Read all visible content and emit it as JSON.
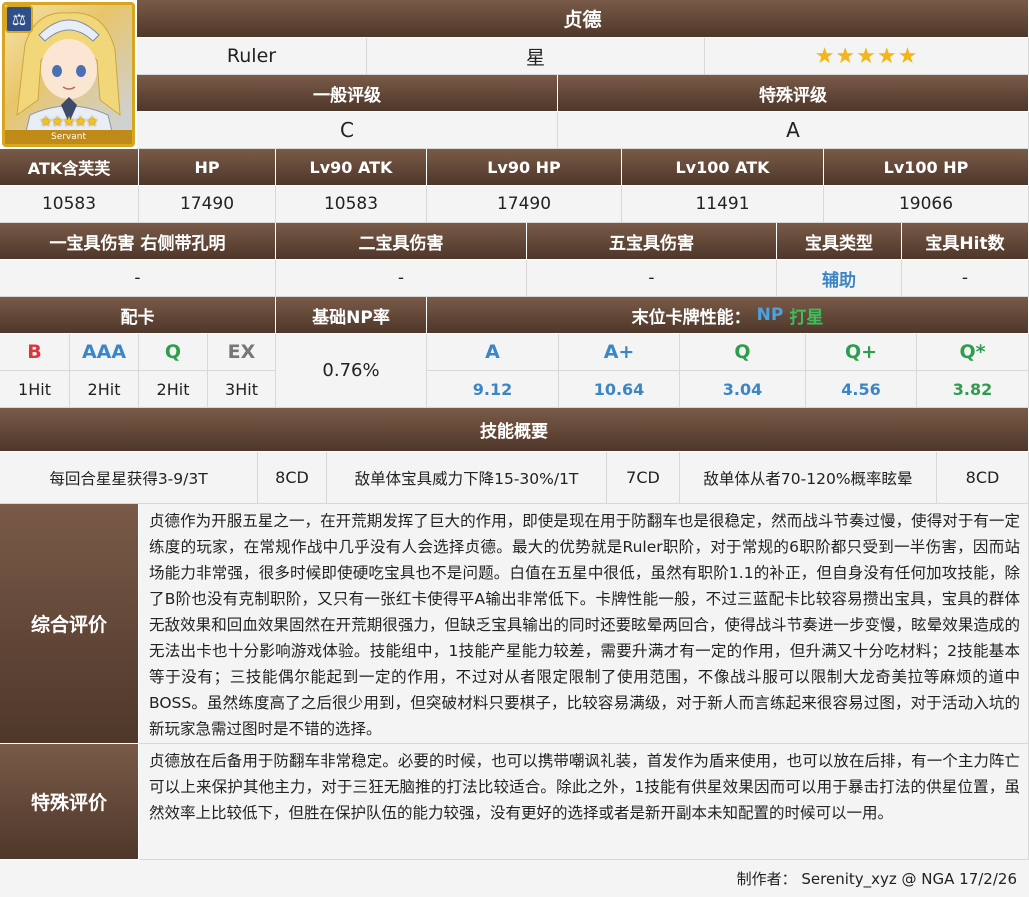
{
  "servant": {
    "name": "贞德",
    "class": "Ruler",
    "attribute": "星",
    "rarity_stars": "★★★★★",
    "card_label": "Servant",
    "card_stars": "★★★★★"
  },
  "ratings": {
    "general_label": "一般评级",
    "special_label": "特殊评级",
    "general_value": "C",
    "special_value": "A"
  },
  "stats": {
    "headers": [
      "ATK含芙芙",
      "HP",
      "Lv90 ATK",
      "Lv90 HP",
      "Lv100 ATK",
      "Lv100 HP"
    ],
    "values": [
      "10583",
      "17490",
      "10583",
      "17490",
      "11491",
      "19066"
    ]
  },
  "np": {
    "headers": [
      "一宝具伤害 右侧带孔明",
      "二宝具伤害",
      "五宝具伤害",
      "宝具类型",
      "宝具Hit数"
    ],
    "values": [
      "-",
      "-",
      "-",
      "辅助",
      "-"
    ]
  },
  "cards": {
    "deck_label": "配卡",
    "np_rate_label": "基础NP率",
    "last_card_label": "末位卡牌性能：",
    "last_card_np": "NP",
    "last_card_star": "打星",
    "deck": [
      "B",
      "AAA",
      "Q",
      "EX"
    ],
    "hits": [
      "1Hit",
      "2Hit",
      "2Hit",
      "3Hit"
    ],
    "np_rate": "0.76%",
    "perf_headers": [
      "A",
      "A+",
      "Q",
      "Q+",
      "Q*"
    ],
    "perf_values": [
      "9.12",
      "10.64",
      "3.04",
      "4.56",
      "3.82"
    ]
  },
  "skills": {
    "title": "技能概要",
    "items": [
      {
        "desc": "每回合星星获得3-9/3T",
        "cd": "8CD"
      },
      {
        "desc": "敌单体宝具威力下降15-30%/1T",
        "cd": "7CD"
      },
      {
        "desc": "敌单体从者70-120%概率眩晕",
        "cd": "8CD"
      }
    ]
  },
  "review": {
    "overall_label": "综合评价",
    "overall_text": "贞德作为开服五星之一，在开荒期发挥了巨大的作用，即使是现在用于防翻车也是很稳定，然而战斗节奏过慢，使得对于有一定练度的玩家，在常规作战中几乎没有人会选择贞德。最大的优势就是Ruler职阶，对于常规的6职阶都只受到一半伤害，因而站场能力非常强，很多时候即使硬吃宝具也不是问题。白值在五星中很低，虽然有职阶1.1的补正，但自身没有任何加攻技能，除了B阶也没有克制职阶，又只有一张红卡使得平A输出非常低下。卡牌性能一般，不过三蓝配卡比较容易攒出宝具，宝具的群体无敌效果和回血效果固然在开荒期很强力，但缺乏宝具输出的同时还要眩晕两回合，使得战斗节奏进一步变慢，眩晕效果造成的无法出卡也十分影响游戏体验。技能组中，1技能产星能力较差，需要升满才有一定的作用，但升满又十分吃材料；2技能基本等于没有；三技能偶尔能起到一定的作用，不过对从者限定限制了使用范围，不像战斗服可以限制大龙奇美拉等麻烦的道中BOSS。虽然练度高了之后很少用到，但突破材料只要棋子，比较容易满级，对于新人而言练起来很容易过图，对于活动入坑的新玩家急需过图时是不错的选择。",
    "special_label": "特殊评价",
    "special_text": "贞德放在后备用于防翻车非常稳定。必要的时候，也可以携带嘲讽礼装，首发作为盾来使用，也可以放在后排，有一个主力阵亡可以上来保护其他主力，对于三狂无脑推的打法比较适合。除此之外，1技能有供星效果因而可以用于暴击打法的供星位置，虽然效率上比较低下，但胜在保护队伍的能力较强，没有更好的选择或者是新开副本未知配置的时候可以一用。"
  },
  "footer": {
    "credit": "制作者：  Serenity_xyz @ NGA  17/2/26"
  }
}
